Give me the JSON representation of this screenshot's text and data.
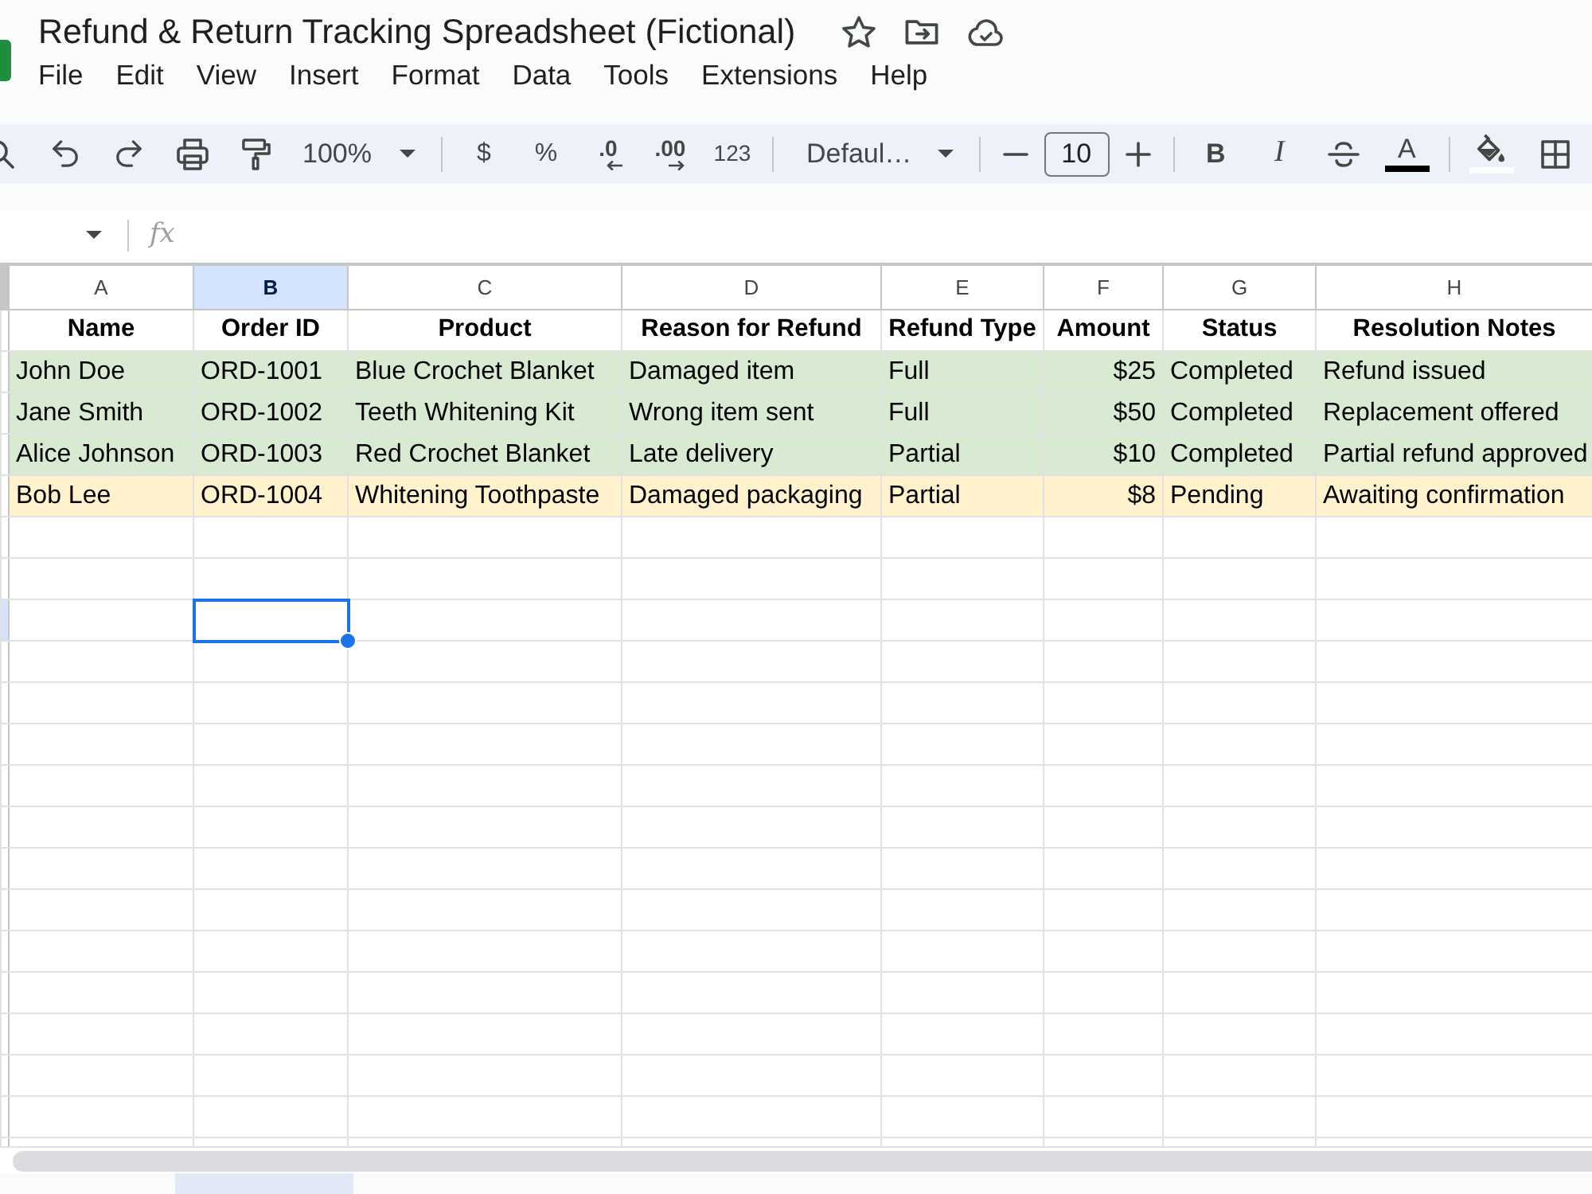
{
  "document": {
    "title": "Refund & Return Tracking Spreadsheet (Fictional)"
  },
  "menu": [
    "File",
    "Edit",
    "View",
    "Insert",
    "Format",
    "Data",
    "Tools",
    "Extensions",
    "Help"
  ],
  "toolbar": {
    "zoom": "100%",
    "number_formats": [
      {
        "label": "$",
        "kind": "plain"
      },
      {
        "label": "%",
        "kind": "plain"
      },
      {
        "label": ".0",
        "kind": "decrease"
      },
      {
        "label": ".00",
        "kind": "increase"
      },
      {
        "label": "123",
        "kind": "plain"
      }
    ],
    "font": "Defaul…",
    "font_size": "10",
    "text_styles": [
      {
        "label": "B",
        "kind": "bold"
      },
      {
        "label": "I",
        "kind": "italic"
      }
    ],
    "text_color": "A"
  },
  "formula_bar": {
    "label": "fx"
  },
  "sheet": {
    "columns": [
      {
        "letter": "A",
        "selected": false,
        "kind": "text"
      },
      {
        "letter": "B",
        "selected": true,
        "kind": "text"
      },
      {
        "letter": "C",
        "selected": false,
        "kind": "text"
      },
      {
        "letter": "D",
        "selected": false,
        "kind": "text"
      },
      {
        "letter": "E",
        "selected": false,
        "kind": "text"
      },
      {
        "letter": "F",
        "selected": false,
        "kind": "number"
      },
      {
        "letter": "G",
        "selected": false,
        "kind": "text"
      },
      {
        "letter": "H",
        "selected": false,
        "kind": "text"
      }
    ],
    "header": [
      "Name",
      "Order ID",
      "Product",
      "Reason for Refund",
      "Refund Type",
      "Amount",
      "Status",
      "Resolution Notes"
    ],
    "rows": [
      {
        "color": "#d9ead3",
        "cells": [
          "John Doe",
          "ORD-1001",
          "Blue Crochet Blanket",
          "Damaged item",
          "Full",
          "$25",
          "Completed",
          "Refund issued"
        ]
      },
      {
        "color": "#d9ead3",
        "cells": [
          "Jane Smith",
          "ORD-1002",
          "Teeth Whitening Kit",
          "Wrong item sent",
          "Full",
          "$50",
          "Completed",
          "Replacement offered"
        ]
      },
      {
        "color": "#d9ead3",
        "cells": [
          "Alice Johnson",
          "ORD-1003",
          "Red Crochet Blanket",
          "Late delivery",
          "Partial",
          "$10",
          "Completed",
          "Partial refund approved"
        ]
      },
      {
        "color": "#fff2cc",
        "cells": [
          "Bob Lee",
          "ORD-1004",
          "Whitening Toothpaste",
          "Damaged packaging",
          "Partial",
          "$8",
          "Pending",
          "Awaiting confirmation"
        ]
      }
    ],
    "blank_rows": [
      {
        "selected": false
      },
      {
        "selected": false
      },
      {
        "selected": true
      },
      {
        "selected": false
      },
      {
        "selected": false
      },
      {
        "selected": false
      },
      {
        "selected": false
      },
      {
        "selected": false
      },
      {
        "selected": false
      },
      {
        "selected": false
      },
      {
        "selected": false
      },
      {
        "selected": false
      },
      {
        "selected": false
      },
      {
        "selected": false
      },
      {
        "selected": false
      },
      {
        "selected": false
      }
    ]
  }
}
